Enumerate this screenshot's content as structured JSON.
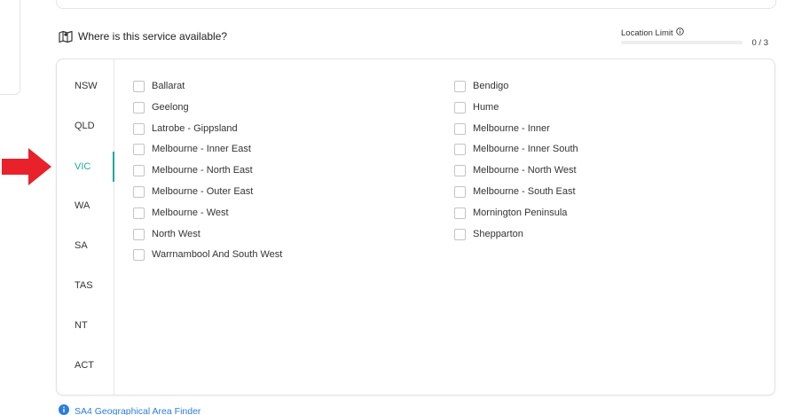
{
  "section": {
    "title": "Where is this service available?",
    "icon": "map-icon"
  },
  "location_limit": {
    "label": "Location Limit",
    "count": "0 / 3",
    "selected": 0,
    "max": 3,
    "info_icon": "info-icon"
  },
  "states": [
    {
      "label": "NSW",
      "active": false
    },
    {
      "label": "QLD",
      "active": false
    },
    {
      "label": "VIC",
      "active": true
    },
    {
      "label": "WA",
      "active": false
    },
    {
      "label": "SA",
      "active": false
    },
    {
      "label": "TAS",
      "active": false
    },
    {
      "label": "NT",
      "active": false
    },
    {
      "label": "ACT",
      "active": false
    }
  ],
  "regions": {
    "left": [
      {
        "label": "Ballarat",
        "checked": false
      },
      {
        "label": "Geelong",
        "checked": false
      },
      {
        "label": "Latrobe - Gippsland",
        "checked": false
      },
      {
        "label": "Melbourne - Inner East",
        "checked": false
      },
      {
        "label": "Melbourne - North East",
        "checked": false
      },
      {
        "label": "Melbourne - Outer East",
        "checked": false
      },
      {
        "label": "Melbourne - West",
        "checked": false
      },
      {
        "label": "North West",
        "checked": false
      },
      {
        "label": "Warrnambool And South West",
        "checked": false
      }
    ],
    "right": [
      {
        "label": "Bendigo",
        "checked": false
      },
      {
        "label": "Hume",
        "checked": false
      },
      {
        "label": "Melbourne - Inner",
        "checked": false
      },
      {
        "label": "Melbourne - Inner South",
        "checked": false
      },
      {
        "label": "Melbourne - North West",
        "checked": false
      },
      {
        "label": "Melbourne - South East",
        "checked": false
      },
      {
        "label": "Mornington Peninsula",
        "checked": false
      },
      {
        "label": "Shepparton",
        "checked": false
      }
    ]
  },
  "finder_link": {
    "label": "SA4 Geographical Area Finder",
    "icon": "info-circle-icon"
  },
  "colors": {
    "accent": "#1aa89a",
    "link": "#2a7de1",
    "arrow": "#e8212a"
  }
}
